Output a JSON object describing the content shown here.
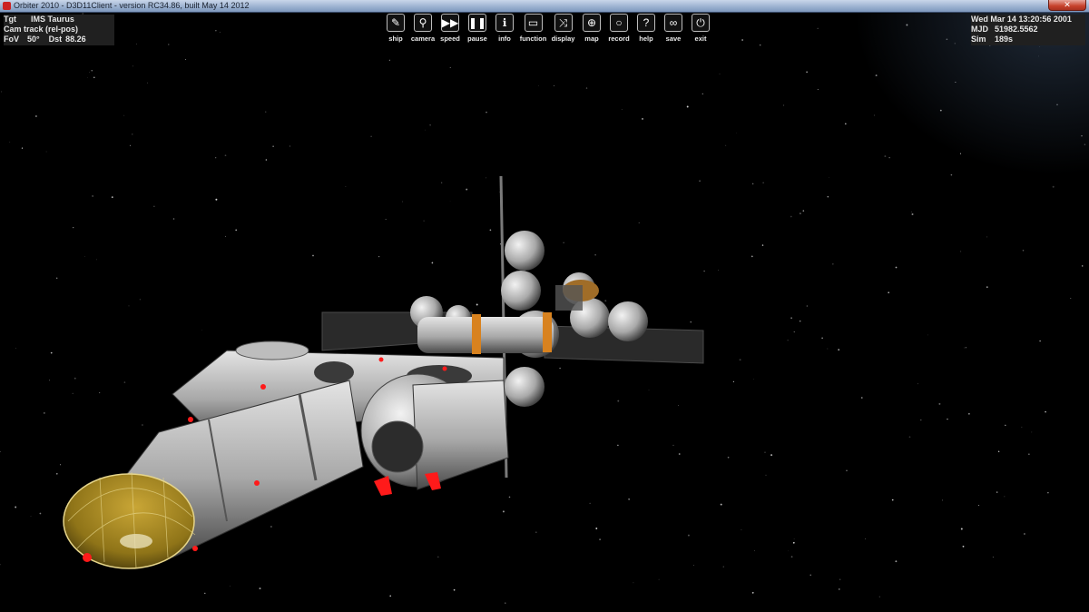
{
  "window": {
    "title": "Orbiter 2010 - D3D11Client - version RC34.86, built May 14 2012",
    "close_label": "✕"
  },
  "hud_left": {
    "target_key": "Tgt",
    "target_value": "IMS Taurus",
    "cam_mode": "Cam track (rel-pos)",
    "fov_key": "FoV",
    "fov_value": "50°",
    "dst_key": "Dst",
    "dst_value": "88.26"
  },
  "hud_right": {
    "date": "Wed Mar 14 13:20:56 2001",
    "mjd_key": "MJD",
    "mjd_value": "51982.5562",
    "sim_key": "Sim",
    "sim_value": "189s"
  },
  "toolbar": {
    "buttons": [
      {
        "label": "ship",
        "icon": "ship-icon",
        "glyph": "✎"
      },
      {
        "label": "camera",
        "icon": "camera-icon",
        "glyph": "⚲"
      },
      {
        "label": "speed",
        "icon": "speed-icon",
        "glyph": "▶▶"
      },
      {
        "label": "pause",
        "icon": "pause-icon",
        "glyph": "❚❚"
      },
      {
        "label": "info",
        "icon": "info-icon",
        "glyph": "ℹ"
      },
      {
        "label": "function",
        "icon": "function-icon",
        "glyph": "▭"
      },
      {
        "label": "display",
        "icon": "display-icon",
        "glyph": "⤨"
      },
      {
        "label": "map",
        "icon": "map-icon",
        "glyph": "⊕"
      },
      {
        "label": "record",
        "icon": "record-icon",
        "glyph": "○"
      },
      {
        "label": "help",
        "icon": "help-icon",
        "glyph": "?"
      },
      {
        "label": "save",
        "icon": "save-icon",
        "glyph": "∞"
      },
      {
        "label": "exit",
        "icon": "exit-icon",
        "glyph": "⏻"
      }
    ]
  },
  "colors": {
    "space": "#000000",
    "hull": "#b9b9b9",
    "dome": "#9a7d1c",
    "beacon": "#ff1a1a"
  }
}
